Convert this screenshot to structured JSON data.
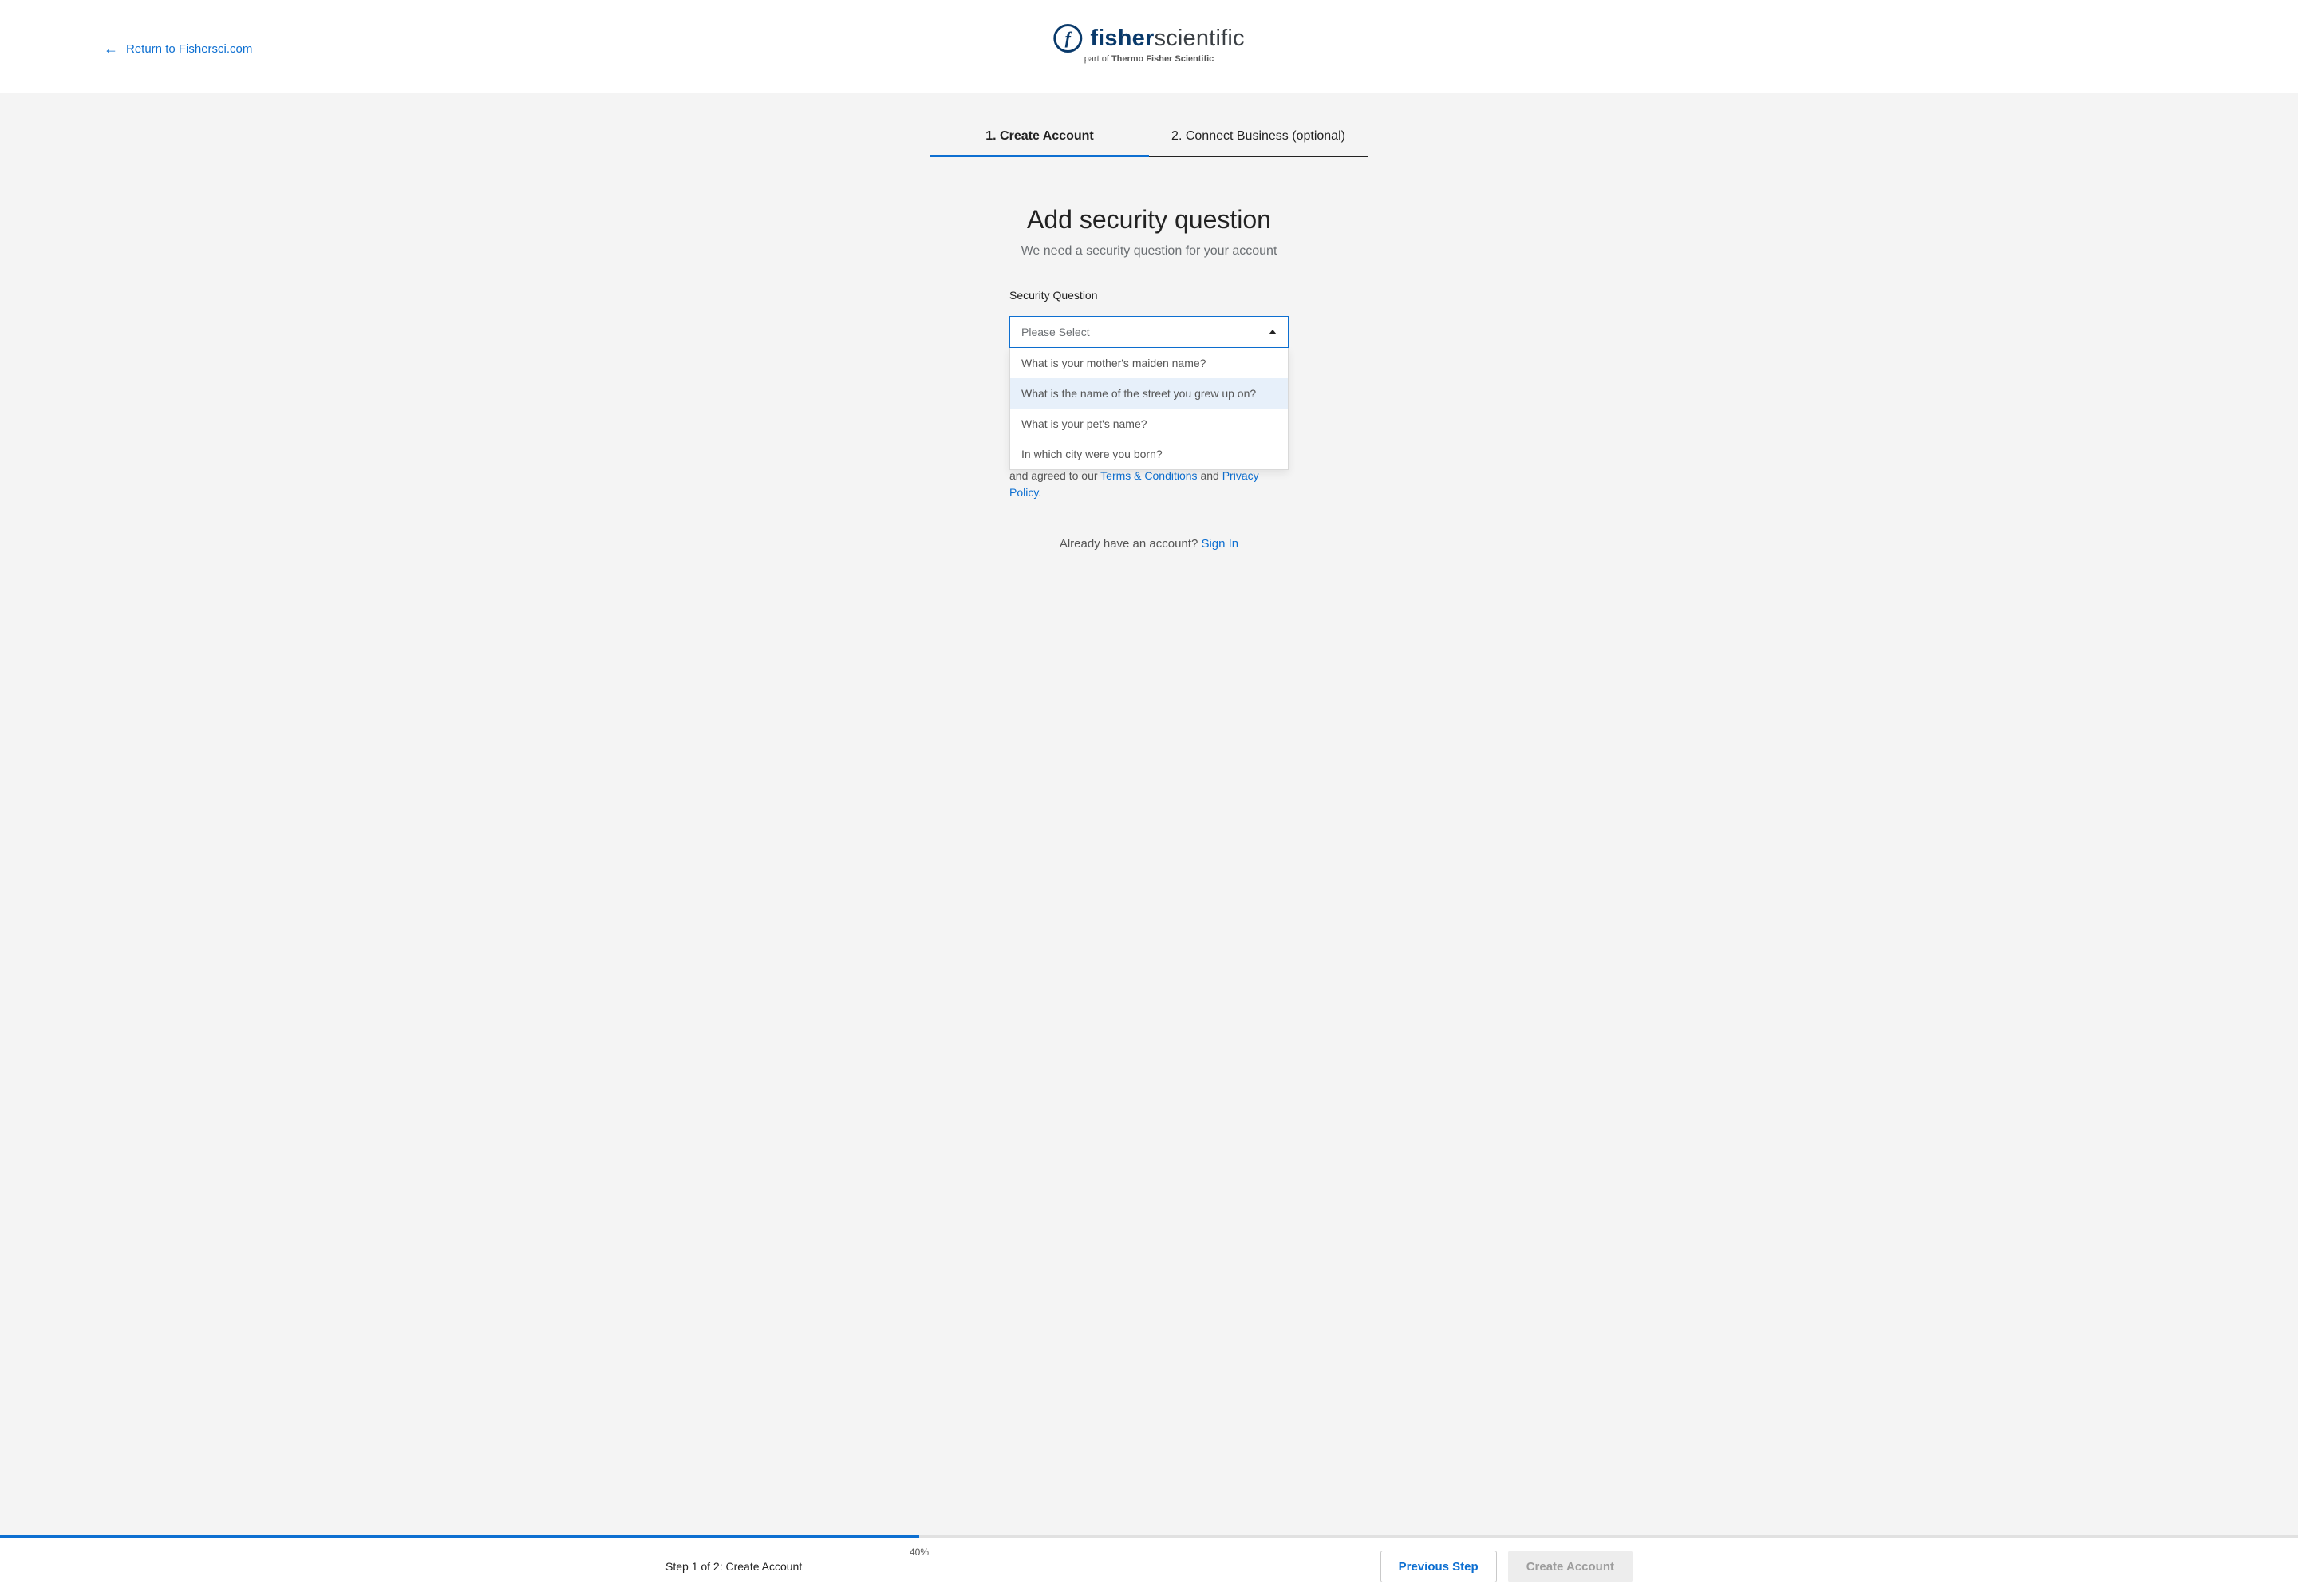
{
  "header": {
    "return_label": "Return to Fishersci.com",
    "brand_bold": "fisher",
    "brand_light": "scientific",
    "brand_sub_prefix": "part of ",
    "brand_sub_bold": "Thermo Fisher Scientific"
  },
  "stepper": {
    "steps": [
      {
        "label": "1. Create Account",
        "active": true
      },
      {
        "label": "2. Connect Business (optional)",
        "active": false
      }
    ]
  },
  "main": {
    "title": "Add security question",
    "subtitle": "We need a security question for your account",
    "field_label": "Security Question",
    "select_placeholder": "Please Select",
    "options": [
      "What is your mother's maiden name?",
      "What is the name of the street you grew up on?",
      "What is your pet's name?",
      "In which city were you born?"
    ],
    "hovered_option_index": 1
  },
  "legal": {
    "line1_visible": "and agreed to our ",
    "terms_label": "Terms & Conditions",
    "and": " and ",
    "privacy_label": "Privacy Policy",
    "period": "."
  },
  "signin": {
    "prompt": "Already have an account? ",
    "link_label": "Sign In"
  },
  "footer": {
    "progress_percent": 40,
    "progress_label": "40%",
    "step_label": "Step 1 of 2: Create Account",
    "prev_label": "Previous Step",
    "create_label": "Create Account"
  }
}
